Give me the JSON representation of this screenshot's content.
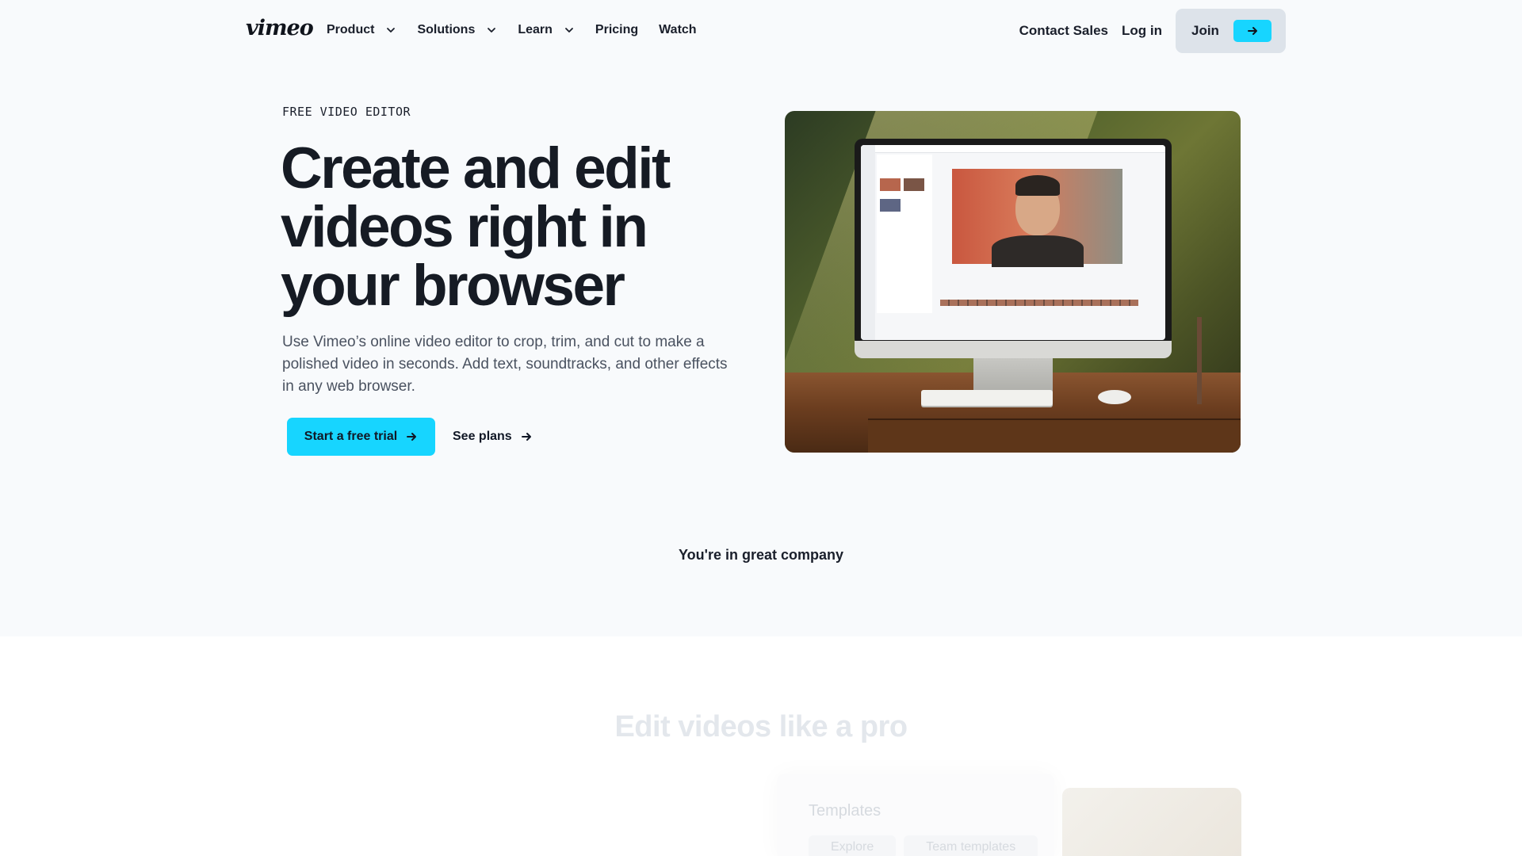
{
  "nav": {
    "logo": "vimeo",
    "items": [
      {
        "label": "Product",
        "dropdown": true
      },
      {
        "label": "Solutions",
        "dropdown": true
      },
      {
        "label": "Learn",
        "dropdown": true
      },
      {
        "label": "Pricing",
        "dropdown": false
      },
      {
        "label": "Watch",
        "dropdown": false
      }
    ],
    "contact_sales": "Contact Sales",
    "login": "Log in",
    "join": "Join"
  },
  "hero": {
    "eyebrow": "FREE VIDEO EDITOR",
    "headline": "Create and edit videos right in your browser",
    "subtext": "Use Vimeo’s online video editor to crop, trim, and cut to make a polished video in seconds. Add text, soundtracks, and other effects in any web browser.",
    "primary_cta": "Start a free trial",
    "secondary_cta": "See plans"
  },
  "company": {
    "label": "You're in great company"
  },
  "features": {
    "title": "Edit videos like a pro",
    "templates": {
      "title": "Templates",
      "tabs": [
        "Explore",
        "Team templates"
      ]
    }
  },
  "colors": {
    "accent": "#17d5ff",
    "hero_bg": "#f8fafc",
    "text": "#1a1f2b"
  },
  "icons": {
    "nav_dropdown": "chevron-down-icon",
    "cta_arrow": "arrow-right-icon"
  }
}
